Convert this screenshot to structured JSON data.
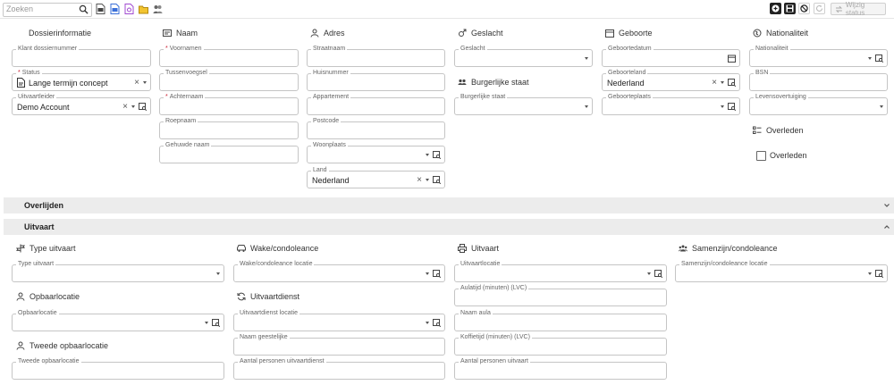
{
  "toolbar": {
    "search_placeholder": "Zoeken",
    "wijzig_status": "Wijzig status"
  },
  "sections": {
    "dossier": {
      "title": "Dossierinformatie",
      "klantnummer": {
        "label": "Klant dossiernummer",
        "value": ""
      },
      "status": {
        "label": "Status",
        "value": "Lange termijn concept"
      },
      "uitvaartleider": {
        "label": "Uitvaartleider",
        "value": "Demo Account"
      }
    },
    "naam": {
      "title": "Naam",
      "voornamen": {
        "label": "Voornamen",
        "value": ""
      },
      "tussenvoegsel": {
        "label": "Tussenvoegsel",
        "value": ""
      },
      "achternaam": {
        "label": "Achternaam",
        "value": ""
      },
      "roepnaam": {
        "label": "Roepnaam",
        "value": ""
      },
      "gehuwde_naam": {
        "label": "Gehuwde naam",
        "value": ""
      }
    },
    "adres": {
      "title": "Adres",
      "straatnaam": {
        "label": "Straatnaam",
        "value": ""
      },
      "huisnummer": {
        "label": "Huisnummer",
        "value": ""
      },
      "appartement": {
        "label": "Appartement",
        "value": ""
      },
      "postcode": {
        "label": "Postcode",
        "value": ""
      },
      "woonplaats": {
        "label": "Woonplaats",
        "value": ""
      },
      "land": {
        "label": "Land",
        "value": "Nederland"
      }
    },
    "geslacht": {
      "title": "Geslacht",
      "geslacht": {
        "label": "Geslacht",
        "value": ""
      }
    },
    "burgerlijke": {
      "title": "Burgerlijke staat",
      "staat": {
        "label": "Burgerlijke staat",
        "value": ""
      }
    },
    "geboorte": {
      "title": "Geboorte",
      "datum": {
        "label": "Geboortedatum",
        "value": ""
      },
      "land": {
        "label": "Geboorteland",
        "value": "Nederland"
      },
      "plaats": {
        "label": "Geboorteplaats",
        "value": ""
      }
    },
    "nationaliteit": {
      "title": "Nationaliteit",
      "nationaliteit": {
        "label": "Nationaliteit",
        "value": ""
      },
      "bsn": {
        "label": "BSN",
        "value": ""
      },
      "levensovertuiging": {
        "label": "Levensovertuiging",
        "value": ""
      }
    },
    "overleden": {
      "title": "Overleden",
      "checkbox_label": "Overleden",
      "checked": false
    }
  },
  "bars": {
    "overlijden": "Overlijden",
    "uitvaart": "Uitvaart"
  },
  "uitvaart": {
    "type": {
      "title": "Type uitvaart",
      "field": {
        "label": "Type uitvaart",
        "value": ""
      }
    },
    "wake": {
      "title": "Wake/condoleance",
      "field": {
        "label": "Wake/condoleance locatie",
        "value": ""
      }
    },
    "uitvaart": {
      "title": "Uitvaart",
      "locatie": {
        "label": "Uitvaartlocatie",
        "value": ""
      },
      "aulatijd": {
        "label": "Aulatijd (minuten) (LVC)",
        "value": ""
      },
      "naam_aula": {
        "label": "Naam aula",
        "value": ""
      },
      "koffietijd": {
        "label": "Koffietijd (minuten) (LVC)",
        "value": ""
      },
      "personen": {
        "label": "Aantal personen uitvaart",
        "value": ""
      }
    },
    "samenzijn": {
      "title": "Samenzijn/condoleance",
      "field": {
        "label": "Samenzijn/condoleance locatie",
        "value": ""
      }
    },
    "opbaar": {
      "title": "Opbaarlocatie",
      "field": {
        "label": "Opbaarlocatie",
        "value": ""
      }
    },
    "uitvaartdienst": {
      "title": "Uitvaartdienst",
      "locatie": {
        "label": "Uitvaartdienst locatie",
        "value": ""
      },
      "geestelijke": {
        "label": "Naam geestelijke",
        "value": ""
      },
      "personen": {
        "label": "Aantal personen uitvaartdienst",
        "value": ""
      }
    },
    "tweede": {
      "title": "Tweede opbaarlocatie",
      "field": {
        "label": "Tweede opbaarlocatie",
        "value": ""
      }
    }
  }
}
